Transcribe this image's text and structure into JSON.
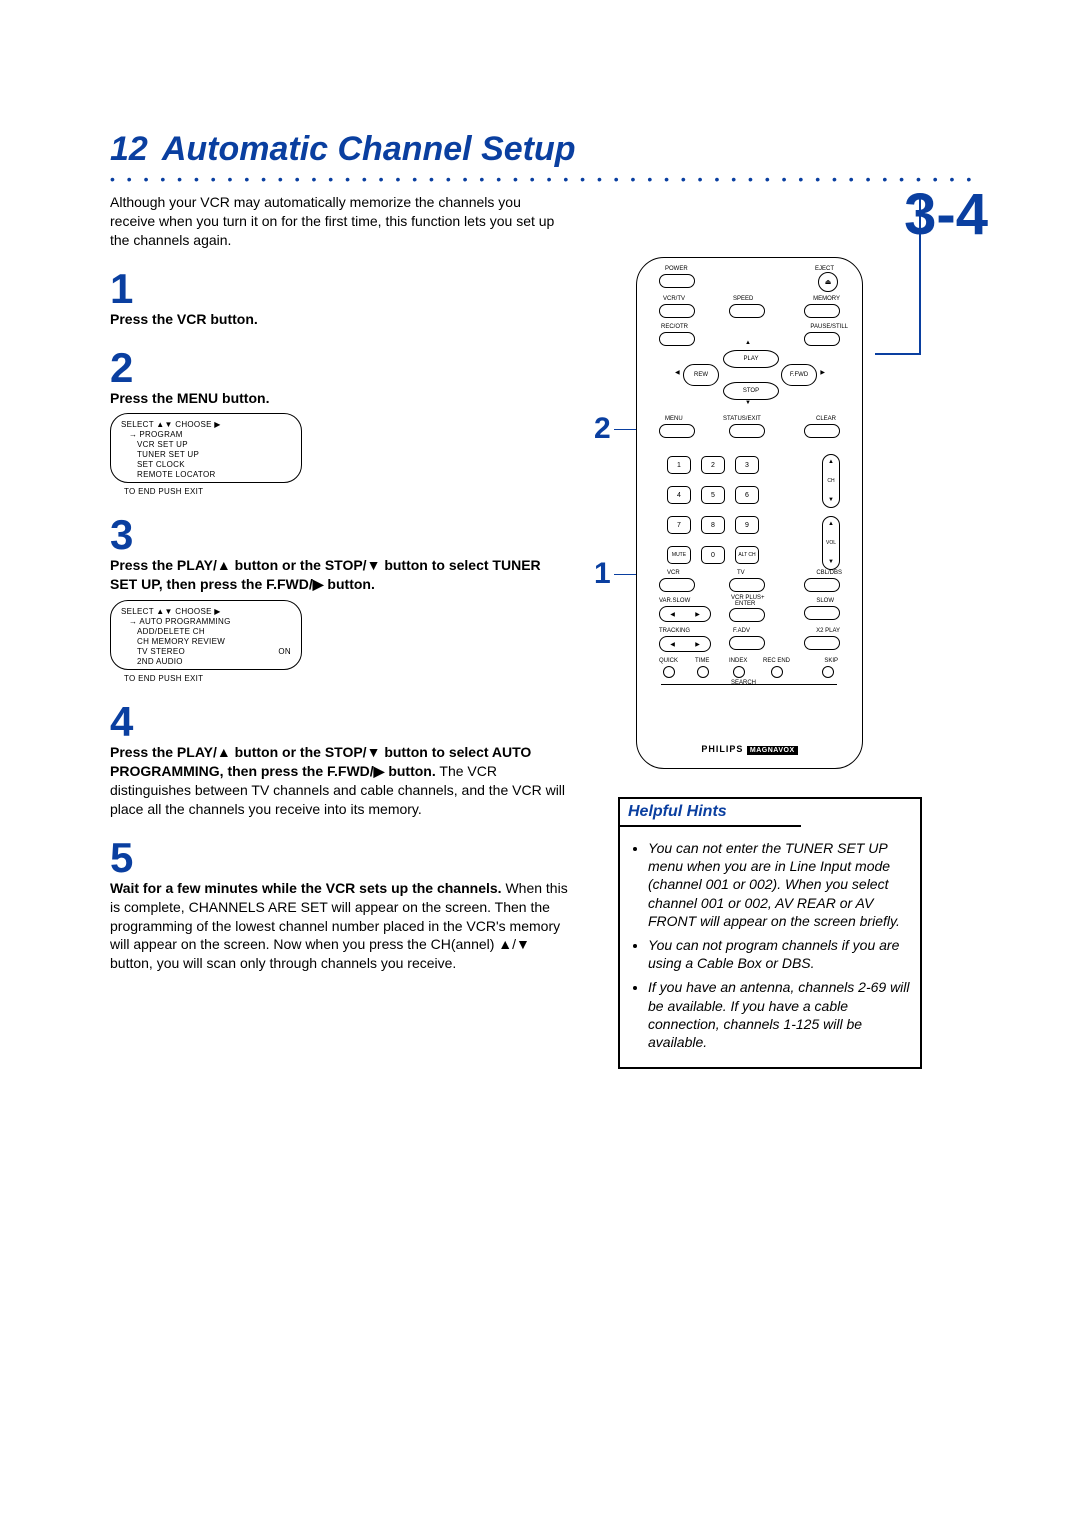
{
  "page_number": "12",
  "title": "Automatic Channel Setup",
  "dots": "• • • • • • • • • • • • • • • • • • • • • • • • • • • • • • • • • • • • • • • • • • • • • • • • • • • • • • • • • • • • • • • • • • • • • • • • • • • • • • • • •",
  "corner_ref": "3-4",
  "intro": "Although your VCR may automatically memorize the channels you receive when you turn it on for the first time, this function lets you set up the channels again.",
  "steps": {
    "s1": {
      "num": "1",
      "bold": "Press the VCR button."
    },
    "s2": {
      "num": "2",
      "bold": "Press the MENU button."
    },
    "s3": {
      "num": "3",
      "bold": "Press the PLAY/▲ button or the STOP/▼ button to select TUNER SET UP, then press the F.FWD/▶ button."
    },
    "s4": {
      "num": "4",
      "bold": "Press the PLAY/▲ button or the STOP/▼ button to select AUTO PROGRAMMING, then press the F.FWD/▶ button.",
      "body": " The VCR distinguishes between TV channels and cable channels, and the VCR will place all the channels you receive into its memory."
    },
    "s5": {
      "num": "5",
      "bold": "Wait for a few minutes while the VCR sets up the channels.",
      "body": " When this is complete, CHANNELS ARE SET will appear on the screen. Then the programming of the lowest channel number placed in the VCR's memory will appear on the screen. Now when you press the CH(annel) ▲/▼ button, you will scan only through channels you receive."
    }
  },
  "osd1": {
    "header": "SELECT ▲▼ CHOOSE ▶",
    "items": [
      "PROGRAM",
      "VCR SET UP",
      "TUNER SET UP",
      "SET CLOCK",
      "REMOTE LOCATOR"
    ],
    "footer": "TO END PUSH EXIT"
  },
  "osd2": {
    "header": "SELECT ▲▼ CHOOSE ▶",
    "items": [
      "AUTO PROGRAMMING",
      "ADD/DELETE CH",
      "CH MEMORY REVIEW",
      "TV STEREO",
      "2ND AUDIO"
    ],
    "right": "ON",
    "footer": "TO END PUSH EXIT"
  },
  "hints": {
    "title": "Helpful Hints",
    "items": [
      "You can not enter the TUNER SET UP menu when you are in Line Input mode (channel 001 or 002). When you select channel 001 or 002, AV REAR or AV FRONT will appear on the screen briefly.",
      "You can not program channels if you are using a Cable Box or DBS.",
      "If you have an antenna, channels 2-69 will be available. If you have a cable connection, channels 1-125 will be available."
    ]
  },
  "remote": {
    "power": "POWER",
    "eject": "EJECT",
    "vcrtv": "VCR/TV",
    "speed": "SPEED",
    "memory": "MEMORY",
    "recotr": "REC/OTR",
    "pausestill": "PAUSE/STILL",
    "play": "PLAY",
    "rew": "REW",
    "ffwd": "F.FWD",
    "stop": "STOP",
    "menu": "MENU",
    "statusexit": "STATUS/EXIT",
    "clear": "CLEAR",
    "k1": "1",
    "k2": "2",
    "k3": "3",
    "k4": "4",
    "k5": "5",
    "k6": "6",
    "k7": "7",
    "k8": "8",
    "k9": "9",
    "k0": "0",
    "mute": "MUTE",
    "altch": "ALT CH",
    "ch": "CH",
    "vol": "VOL",
    "vcr": "VCR",
    "tv": "TV",
    "cbldbs": "CBL/DBS",
    "varslow": "VAR.SLOW",
    "vcrplus": "VCR PLUS+",
    "enter": "ENTER",
    "slow": "SLOW",
    "tracking": "TRACKING",
    "fadv": "F.ADV",
    "x2": "X2 PLAY",
    "quick": "QUICK",
    "time": "TIME",
    "index": "INDEX",
    "recend": "REC END",
    "skip": "SKIP",
    "search": "SEARCH",
    "brand1": "PHILIPS",
    "brand2": "MAGNAVOX",
    "callout1": "1",
    "callout2": "2"
  }
}
